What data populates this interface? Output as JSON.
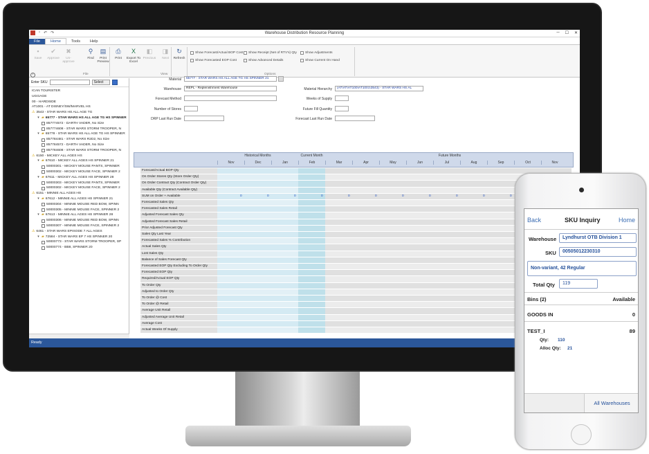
{
  "window": {
    "title": "Warehouse Distribution Resource Planning",
    "controls": [
      "─",
      "☐",
      "✕"
    ]
  },
  "menu": {
    "file": "File",
    "home": "Home",
    "tools": "Tools",
    "help": "Help"
  },
  "ribbon": {
    "buttons": [
      {
        "label": "Save",
        "icon": "save-icon",
        "glyph": "▪",
        "disabled": true
      },
      {
        "label": "Approve",
        "icon": "approve-icon",
        "glyph": "✔",
        "disabled": true
      },
      {
        "label": "Un-approve",
        "icon": "unapprove-icon",
        "glyph": "✖",
        "disabled": true
      },
      {
        "label": "Find",
        "icon": "binoculars-icon",
        "glyph": "⚲",
        "disabled": false
      },
      {
        "label": "Print Preview",
        "icon": "print-preview-icon",
        "glyph": "▤",
        "disabled": false
      },
      {
        "label": "Print",
        "icon": "print-icon",
        "glyph": "⎙",
        "disabled": false
      },
      {
        "label": "Export To Excel",
        "icon": "excel-icon",
        "glyph": "X",
        "disabled": false
      },
      {
        "label": "Previous",
        "icon": "previous-icon",
        "glyph": "◧",
        "disabled": true
      },
      {
        "label": "Next",
        "icon": "next-icon",
        "glyph": "◨",
        "disabled": true
      },
      {
        "label": "Refresh",
        "icon": "refresh-icon",
        "glyph": "↻",
        "disabled": false
      }
    ],
    "groups": {
      "file": "File",
      "view": "View",
      "options": "Options"
    },
    "options": [
      "Show Forecast/Actual BOP Cost",
      "Show Forecasted EOP Cost",
      "Show Receipt (Net of RTV's) Qty",
      "Show Advanced Details",
      "Show Adjustments",
      "Show Current On Hand"
    ]
  },
  "sku_search": {
    "label": "Enter SKU",
    "select": "Select",
    "go": "▸"
  },
  "tree": [
    {
      "level": 1,
      "kind": "text",
      "text": "ICAN TOURISTER"
    },
    {
      "level": 1,
      "kind": "text",
      "text": "UGGAGE"
    },
    {
      "level": 1,
      "kind": "text",
      "text": "00 - HARDSIDE"
    },
    {
      "level": 1,
      "kind": "text",
      "text": "AT1001 - AT DISNEY/SW/MARVEL HS"
    },
    {
      "level": 1,
      "kind": "warn",
      "text": "3543 - STAR WARS HS ALL AGE TG"
    },
    {
      "level": 2,
      "kind": "folder",
      "text": "65777 - STAR WARS HS ALL AGE TG HS SPINNER",
      "bold": true
    },
    {
      "level": 3,
      "kind": "check",
      "text": "857774572 - DARTH VADER, No Size"
    },
    {
      "level": 3,
      "kind": "check",
      "text": "857774608 - STAR WARS STORM TROOPER, N"
    },
    {
      "level": 2,
      "kind": "folder",
      "text": "65778 - STAR WARS HS ALL AGE TG HS SPINNER"
    },
    {
      "level": 3,
      "kind": "check",
      "text": "857784481 - STAR WARS R2D2, No Size"
    },
    {
      "level": 3,
      "kind": "check",
      "text": "857784572 - DARTH VADER, No Size"
    },
    {
      "level": 3,
      "kind": "check",
      "text": "857784608 - STAR WARS STORM TROOPER, N"
    },
    {
      "level": 1,
      "kind": "warn",
      "text": "6150 - MICKEY ALL AGES HS"
    },
    {
      "level": 2,
      "kind": "folder",
      "text": "67610 - MICKEY ALL AGES HS SPINNER 21"
    },
    {
      "level": 3,
      "kind": "check",
      "text": "50000301 - MICKEY MOUSE PANTS, SPINNER"
    },
    {
      "level": 3,
      "kind": "check",
      "text": "50000302 - MICKEY MOUSE FACE, SPINNER 2"
    },
    {
      "level": 2,
      "kind": "folder",
      "text": "67611 - MICKEY ALL AGES HS SPINNER 28"
    },
    {
      "level": 3,
      "kind": "check",
      "text": "50000303 - MICKEY MOUSE PANTS, SPINNER"
    },
    {
      "level": 3,
      "kind": "check",
      "text": "50000302 - MICKEY MOUSE FACE, SPINNER 2"
    },
    {
      "level": 1,
      "kind": "warn",
      "text": "6151 - MINNIE ALL AGES HS"
    },
    {
      "level": 2,
      "kind": "folder",
      "text": "67612 - MINNIE ALL AGES HS SPINNER 21"
    },
    {
      "level": 3,
      "kind": "check",
      "text": "50000304 - MINNIE MOUSE RED BOW, SPINN"
    },
    {
      "level": 3,
      "kind": "check",
      "text": "50000305 - MINNIE MOUSE FACE, SPINNER 2"
    },
    {
      "level": 2,
      "kind": "folder",
      "text": "67613 - MINNIE ALL AGES HS SPINNER 28"
    },
    {
      "level": 3,
      "kind": "check",
      "text": "50000306 - MINNIE MOUSE RED BOW, SPINN"
    },
    {
      "level": 3,
      "kind": "check",
      "text": "50000307 - MINNIE MOUSE FACE, SPINNER 2"
    },
    {
      "level": 1,
      "kind": "warn",
      "text": "6461 - STAR WARS EPISODE 7 ALL AGES"
    },
    {
      "level": 2,
      "kind": "folder",
      "text": "72584 - STAR WARS EP 7 HS SPINNER 20"
    },
    {
      "level": 3,
      "kind": "check",
      "text": "50000773 - STAR WARS STORM TROOPER, SP"
    },
    {
      "level": 3,
      "kind": "check",
      "text": "50000774 - BB8, SPINNER 20"
    }
  ],
  "form": {
    "material_label": "Material",
    "material_value": "65777 - STAR WARS HS ALL AGE TG HS SPINNER 21",
    "warehouse_label": "Warehouse",
    "warehouse_value": "REPL - Replenishment Warehouse",
    "hierarchy_label": "Material Hierarchy",
    "hierarchy_value": "(AT\\AT\\AT100\\AT1001\\3543) - STAR WARS HS AL",
    "forecast_method_label": "Forecast Method",
    "weeks_supply_label": "Weeks of Supply",
    "num_stores_label": "Number of Stores",
    "future_fill_label": "Future Fill Quantity",
    "drp_last_run_label": "DRP Last Run Date",
    "forecast_last_run_label": "Forecast Last Run Date"
  },
  "grid": {
    "groups": {
      "historical": "Historical Months",
      "current": "Current Month",
      "future": "Future Months"
    },
    "months": [
      "Nov",
      "Dec",
      "Jan",
      "Feb",
      "Mar",
      "Apr",
      "May",
      "Jun",
      "Jul",
      "Aug",
      "Sep",
      "Oct",
      "Nov"
    ],
    "rows": [
      "Forecast/Actual BOP Qty",
      "On Order Stores Qty (Store Order Qty)",
      "On Order Contract Qty (Contract Order Qty)",
      "Available Qty (Contract Available Qty)",
      "SUM on Order + Available",
      "Forecasted Sales Qty",
      "Forecasted Sales Retail",
      "Adjusted Forecast Sales Qty",
      "Adjusted Forecast Sales Retail",
      "Prior Adjusted Forecast Qty",
      "Sales Qty Last Year",
      "Forecasted Sales % Contribution",
      "Actual Sales Qty",
      "Lost Sales Qty",
      "Balance of Sales Forecast Qty",
      "Forecasted EOP Qty Excluding To Order Qty",
      "Forecasted EOP Qty",
      "Required/Actual EOP Qty",
      "To Order Qty",
      "Adjusted to Order Qty",
      "To Order @ Cost",
      "To Order @ Retail",
      "Average Unit Retail",
      "Adjusted Average Unit Retail",
      "Average Cost",
      "Actual Weeks Of Supply"
    ],
    "sum_values": [
      "0",
      "0",
      "0",
      "0",
      "0",
      "0",
      "0",
      "0",
      "0",
      "0",
      "0",
      "0",
      "0"
    ]
  },
  "status": "Ready",
  "phone": {
    "back": "Back",
    "title": "SKU Inquiry",
    "home": "Home",
    "warehouse_label": "Warehouse",
    "warehouse_value": "Lyndhurst OTB Division 1",
    "sku_label": "SKU",
    "sku_value": "00505012230310",
    "variant": "Non-variant, 42 Regular",
    "total_label": "Total Qty",
    "total_value": "119",
    "bins": "Bins (2)",
    "available": "Available",
    "goods_in": "GOODS IN",
    "goods_in_qty": "0",
    "test": "TEST_I",
    "test_qty": "89",
    "qty_label": "Qty:",
    "qty_value": "110",
    "alloc_label": "Alloc Qty:",
    "alloc_value": "21",
    "all_warehouses": "All Warehouses"
  }
}
